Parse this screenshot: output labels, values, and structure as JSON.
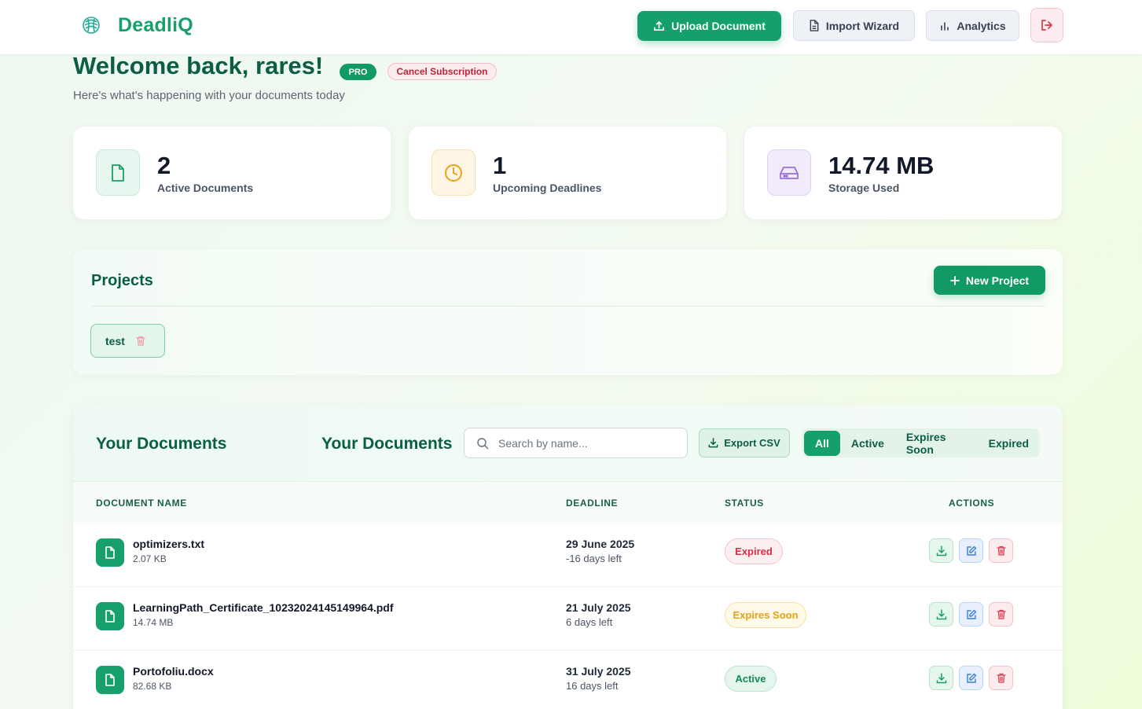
{
  "header": {
    "app_name": "DeadliQ",
    "upload_label": "Upload Document",
    "import_label": "Import Wizard",
    "analytics_label": "Analytics",
    "icons": {
      "logo": "brain-logo-icon",
      "upload": "upload-icon",
      "import": "document-icon",
      "analytics": "bar-chart-icon",
      "logout": "logout-icon"
    }
  },
  "welcome": {
    "title": "Welcome back, rares!",
    "plan_badge": "PRO",
    "cancel_label": "Cancel Subscription",
    "subtitle": "Here's what's happening with your documents today"
  },
  "stats": [
    {
      "value": "2",
      "label": "Active Documents",
      "icon": "file-icon",
      "color": "#17a06b"
    },
    {
      "value": "1",
      "label": "Upcoming Deadlines",
      "icon": "clock-icon",
      "color": "#e8a21b"
    },
    {
      "value": "14.74 MB",
      "label": "Storage Used",
      "icon": "hard-drive-icon",
      "color": "#9a6fd6"
    }
  ],
  "projects": {
    "title": "Projects",
    "new_label": "New Project",
    "items": [
      {
        "name": "test"
      }
    ]
  },
  "documents": {
    "title": "Your Documents",
    "title_repeat": "Your Documents",
    "search_placeholder": "Search by name...",
    "export_label": "Export CSV",
    "filters": [
      "All",
      "Active",
      "Expires Soon",
      "Expired"
    ],
    "active_filter": "All",
    "columns": {
      "name": "DOCUMENT NAME",
      "deadline": "DEADLINE",
      "status": "STATUS",
      "actions": "ACTIONS"
    },
    "rows": [
      {
        "name": "optimizers.txt",
        "size": "2.07 KB",
        "deadline": "29 June 2025",
        "days_left": "-16 days left",
        "status": "Expired"
      },
      {
        "name": "LearningPath_Certificate_10232024145149964.pdf",
        "size": "14.74 MB",
        "deadline": "21 July 2025",
        "days_left": "6 days left",
        "status": "Expires Soon"
      },
      {
        "name": "Portofoliu.docx",
        "size": "82.68 KB",
        "deadline": "31 July 2025",
        "days_left": "16 days left",
        "status": "Active"
      }
    ]
  },
  "colors": {
    "brand": "#14a06a",
    "brand_dark": "#0b5e44",
    "expired": "#d32f45",
    "soon": "#e2a21a",
    "active": "#138a5a"
  }
}
